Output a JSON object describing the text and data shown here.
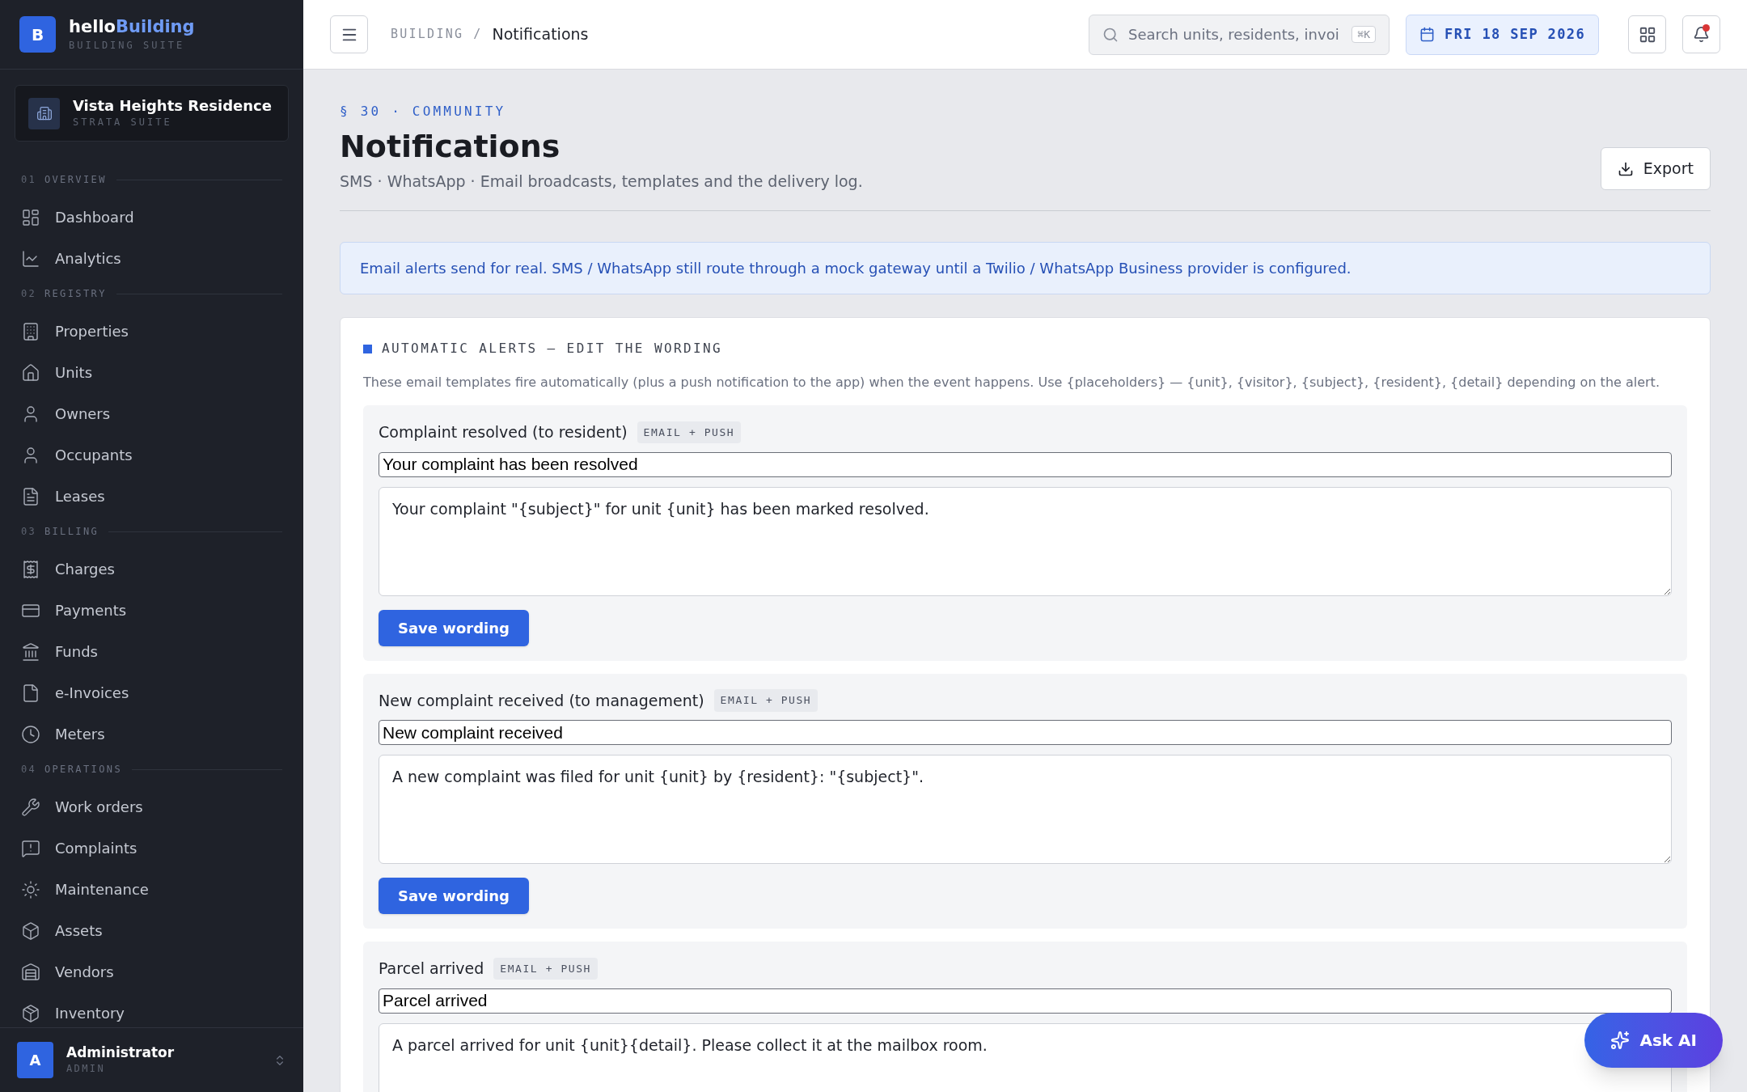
{
  "brand": {
    "logo_letter": "B",
    "name_first": "hello",
    "name_second": "Building",
    "subtitle": "BUILDING SUITE"
  },
  "property": {
    "name": "Vista Heights Residence",
    "subtitle": "STRATA SUITE"
  },
  "sidebar": {
    "sections": [
      {
        "number": "01",
        "title": "OVERVIEW",
        "items": [
          {
            "label": "Dashboard"
          },
          {
            "label": "Analytics"
          }
        ]
      },
      {
        "number": "02",
        "title": "REGISTRY",
        "items": [
          {
            "label": "Properties"
          },
          {
            "label": "Units"
          },
          {
            "label": "Owners"
          },
          {
            "label": "Occupants"
          },
          {
            "label": "Leases"
          }
        ]
      },
      {
        "number": "03",
        "title": "BILLING",
        "items": [
          {
            "label": "Charges"
          },
          {
            "label": "Payments"
          },
          {
            "label": "Funds"
          },
          {
            "label": "e-Invoices"
          },
          {
            "label": "Meters"
          }
        ]
      },
      {
        "number": "04",
        "title": "OPERATIONS",
        "items": [
          {
            "label": "Work orders"
          },
          {
            "label": "Complaints"
          },
          {
            "label": "Maintenance"
          },
          {
            "label": "Assets"
          },
          {
            "label": "Vendors"
          },
          {
            "label": "Inventory"
          }
        ]
      }
    ]
  },
  "user": {
    "avatar_letter": "A",
    "name": "Administrator",
    "role": "ADMIN"
  },
  "header": {
    "breadcrumb": [
      "BUILDING",
      "/",
      "Notifications"
    ],
    "search": {
      "placeholder": "Search units, residents, invoi",
      "shortcut": "⌘K"
    },
    "date": "FRI 18 SEP 2026",
    "notifications": {
      "has_unread": true
    }
  },
  "page": {
    "eyebrow": "§ 30 · COMMUNITY",
    "title": "Notifications",
    "subtitle": "SMS · WhatsApp · Email broadcasts, templates and the delivery log.",
    "export_button": "Export"
  },
  "info_banner": "Email alerts send for real. SMS / WhatsApp still route through a mock gateway until a Twilio / WhatsApp Business provider is configured.",
  "alerts_card": {
    "title": "AUTOMATIC ALERTS — EDIT THE WORDING",
    "description": "These email templates fire automatically (plus a push notification to the app) when the event happens. Use {placeholders} — {unit}, {visitor}, {subject}, {resident}, {detail} depending on the alert.",
    "templates": [
      {
        "name": "Complaint resolved (to resident)",
        "channel": "EMAIL + PUSH",
        "subject": "Your complaint has been resolved",
        "body": "Your complaint \"{subject}\" for unit {unit} has been marked resolved.",
        "save_button": "Save wording"
      },
      {
        "name": "New complaint received (to management)",
        "channel": "EMAIL + PUSH",
        "subject": "New complaint received",
        "body": "A new complaint was filed for unit {unit} by {resident}: \"{subject}\".",
        "save_button": "Save wording"
      },
      {
        "name": "Parcel arrived",
        "channel": "EMAIL + PUSH",
        "subject": "Parcel arrived",
        "body": "A parcel arrived for unit {unit}{detail}. Please collect it at the mailbox room."
      }
    ]
  },
  "ask_ai_button": "Ask AI"
}
